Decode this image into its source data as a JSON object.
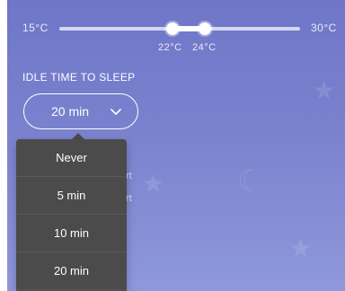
{
  "temperature": {
    "min_label": "15°C",
    "max_label": "30°C",
    "low_value": "22°C",
    "high_value": "24°C"
  },
  "idle": {
    "title": "IDLE TIME TO SLEEP",
    "selected": "20 min",
    "options": [
      "Never",
      "5 min",
      "10 min",
      "20 min"
    ]
  },
  "behind": {
    "line1": "rt",
    "line2": "rt"
  },
  "icons": {
    "chevron": "chevron-down-icon",
    "star": "star-icon"
  },
  "colors": {
    "menu_bg": "#4b4b4b",
    "panel_top": "#6f76c8",
    "panel_bottom": "#8e98db"
  }
}
